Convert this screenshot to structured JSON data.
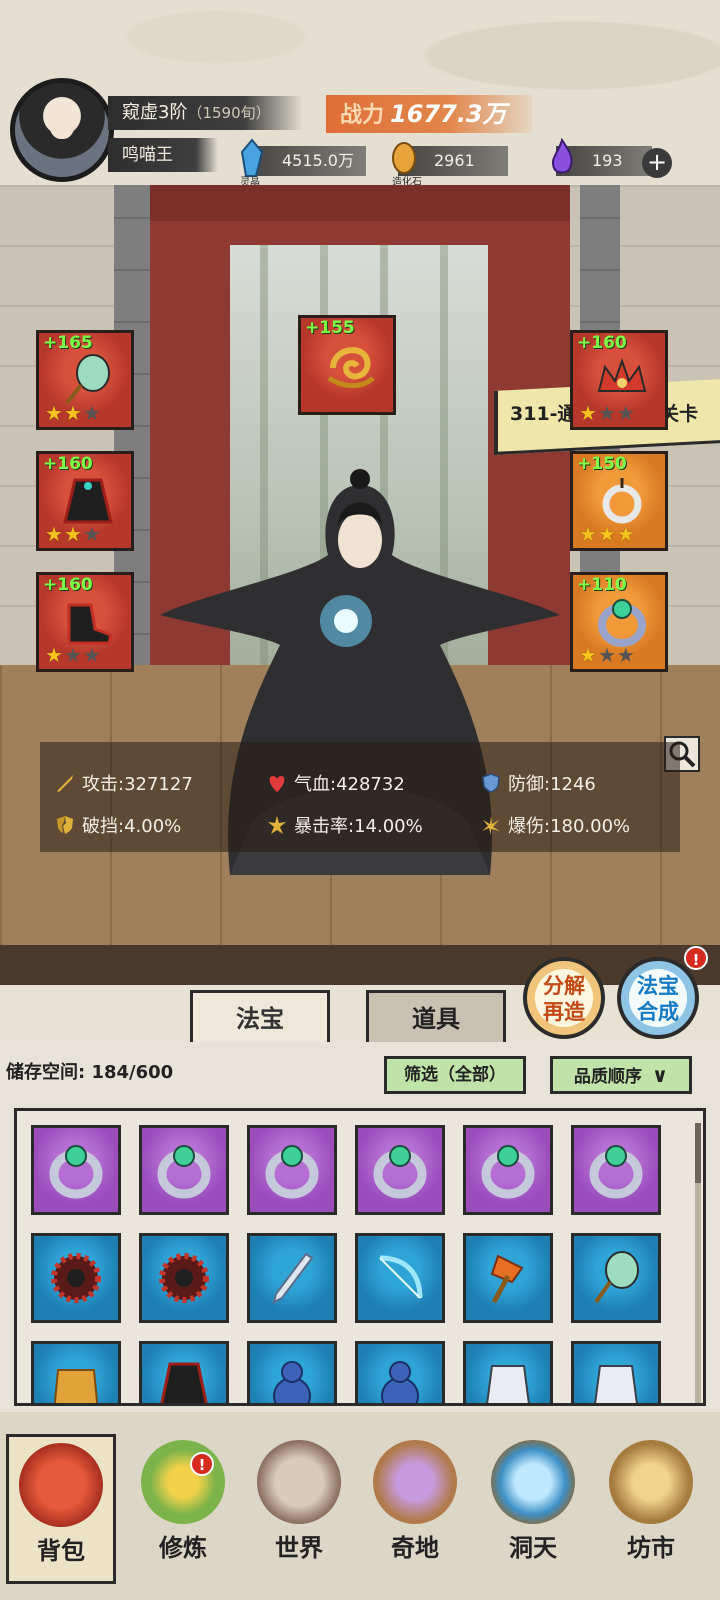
{
  "player": {
    "rank": "窥虚3阶",
    "lifespan": "（1590旬）",
    "name": "鸣喵王"
  },
  "power": {
    "label": "战力",
    "value": "1677.3万"
  },
  "resources": [
    {
      "icon": "spirit-crystal-icon",
      "label": "灵晶",
      "value": "4515.0万",
      "color": "#4aa3e0"
    },
    {
      "icon": "creation-stone-icon",
      "label": "造化石",
      "value": "2961",
      "color": "#e8a33a"
    },
    {
      "icon": "purple-flame-icon",
      "label": "",
      "value": "193",
      "color": "#8b4fe0"
    }
  ],
  "quest": {
    "text": "311-通过第41幕关卡"
  },
  "equipment": [
    {
      "slot": "left-1",
      "plus": "+165",
      "stars": 2,
      "max_stars": 3,
      "color": "red"
    },
    {
      "slot": "center-top",
      "plus": "+155",
      "stars": 0,
      "max_stars": 0,
      "color": "red"
    },
    {
      "slot": "right-1",
      "plus": "+160",
      "stars": 1,
      "max_stars": 3,
      "color": "red"
    },
    {
      "slot": "left-2",
      "plus": "+160",
      "stars": 2,
      "max_stars": 3,
      "color": "red"
    },
    {
      "slot": "right-2",
      "plus": "+150",
      "stars": 3,
      "max_stars": 3,
      "color": "orange"
    },
    {
      "slot": "left-3",
      "plus": "+160",
      "stars": 1,
      "max_stars": 3,
      "color": "red"
    },
    {
      "slot": "right-3",
      "plus": "+110",
      "stars": 1,
      "max_stars": 3,
      "color": "orange"
    }
  ],
  "stats": {
    "attack": {
      "label": "攻击:",
      "value": "327127"
    },
    "hp": {
      "label": "气血:",
      "value": "428732"
    },
    "defense": {
      "label": "防御:",
      "value": "1246"
    },
    "pierce": {
      "label": "破挡:",
      "value": "4.00%"
    },
    "crit_rate": {
      "label": "暴击率:",
      "value": "14.00%"
    },
    "crit_dmg": {
      "label": "爆伤:",
      "value": "180.00%"
    }
  },
  "actions": {
    "decompose": "分解再造",
    "decompose_line1": "分解",
    "decompose_line2": "再造",
    "synthesize_line1": "法宝",
    "synthesize_line2": "合成",
    "badge": "!"
  },
  "tabs": {
    "treasure": "法宝",
    "items": "道具"
  },
  "inventory": {
    "storage_label": "储存空间:",
    "storage_value": "184/600",
    "filter": "筛选（全部）",
    "sort": "品质顺序",
    "rows": [
      [
        "purple-ring",
        "purple-ring",
        "purple-ring",
        "purple-ring",
        "purple-ring",
        "purple-ring"
      ],
      [
        "blue-spiked-disc",
        "blue-spiked-disc",
        "blue-sword",
        "blue-bow",
        "blue-axe",
        "blue-fan"
      ],
      [
        "blue-armor",
        "blue-robe",
        "blue-gourd",
        "blue-gourd",
        "blue-white-armor",
        "blue-white-armor"
      ]
    ]
  },
  "nav": [
    {
      "label": "背包",
      "icon": "backpack-icon",
      "color": "#c5402f"
    },
    {
      "label": "修炼",
      "icon": "cultivation-icon",
      "color": "#7cb34a"
    },
    {
      "label": "世界",
      "icon": "world-scroll-icon",
      "color": "#a2877a"
    },
    {
      "label": "奇地",
      "icon": "wonderland-icon",
      "color": "#b58fd0"
    },
    {
      "label": "洞天",
      "icon": "portal-icon",
      "color": "#5aa0c8"
    },
    {
      "label": "坊市",
      "icon": "market-icon",
      "color": "#c9a36a"
    }
  ],
  "nav_badge": "!"
}
